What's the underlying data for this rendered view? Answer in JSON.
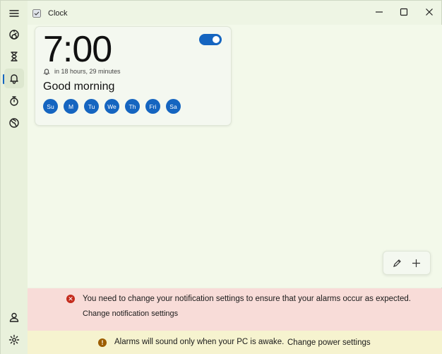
{
  "window": {
    "title": "Clock"
  },
  "nav": {
    "items": [
      {
        "name": "menu",
        "icon": "hamburger-icon"
      },
      {
        "name": "focus-sessions",
        "icon": "focus-icon"
      },
      {
        "name": "timer",
        "icon": "hourglass-icon"
      },
      {
        "name": "alarm",
        "icon": "bell-icon",
        "active": true
      },
      {
        "name": "stopwatch",
        "icon": "stopwatch-icon"
      },
      {
        "name": "world-clock",
        "icon": "globe-icon"
      }
    ],
    "bottom": [
      {
        "name": "account",
        "icon": "person-icon"
      },
      {
        "name": "settings",
        "icon": "gear-icon"
      }
    ]
  },
  "alarm": {
    "time": "7:00",
    "enabled": true,
    "countdown": "in 18 hours, 29 minutes",
    "name": "Good morning",
    "days": [
      "Su",
      "M",
      "Tu",
      "We",
      "Th",
      "Fri",
      "Sa"
    ]
  },
  "error_banner": {
    "message": "You need to change your notification settings to ensure that your alarms occur as expected.",
    "link": "Change notification settings"
  },
  "warning_banner": {
    "message": "Alarms will sound only when your PC is awake.",
    "link": "Change power settings"
  },
  "colors": {
    "accent": "#1565c0",
    "error": "#c42b1c",
    "warning": "#9c5d00"
  }
}
